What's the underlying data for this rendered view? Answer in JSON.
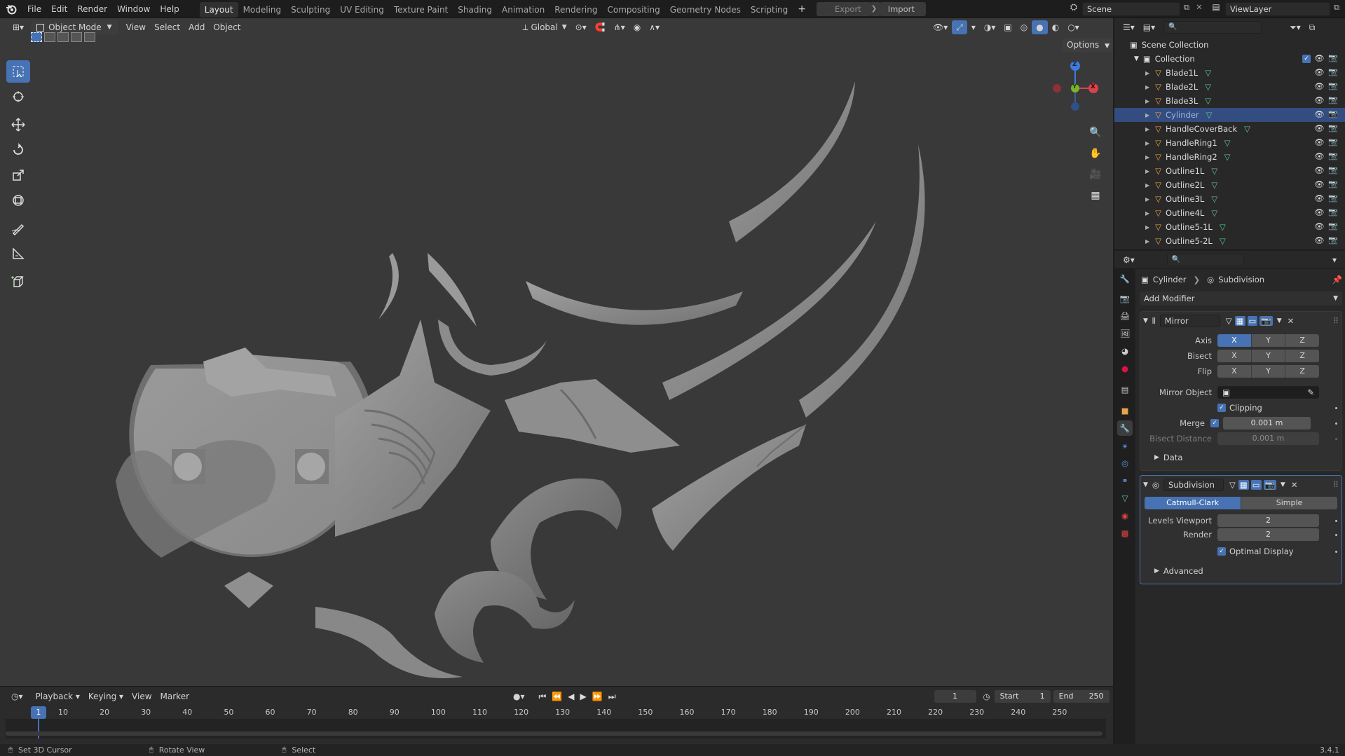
{
  "menu": {
    "items": [
      "File",
      "Edit",
      "Render",
      "Window",
      "Help"
    ],
    "workspaces": [
      "Layout",
      "Modeling",
      "Sculpting",
      "UV Editing",
      "Texture Paint",
      "Shading",
      "Animation",
      "Rendering",
      "Compositing",
      "Geometry Nodes",
      "Scripting"
    ],
    "active_workspace": "Layout",
    "add_workspace": "+",
    "export_label": "Export",
    "import_label": "Import",
    "scene_name": "Scene",
    "view_layer_name": "ViewLayer"
  },
  "viewport_header": {
    "mode": "Object Mode",
    "menus": [
      "View",
      "Select",
      "Add",
      "Object"
    ],
    "transform_orientation": "Global",
    "options_label": "Options"
  },
  "gizmo": {
    "x": "X",
    "y": "Y",
    "z": "Z"
  },
  "outliner": {
    "scene_collection": "Scene Collection",
    "collection": "Collection",
    "objects": [
      {
        "name": "Blade1L",
        "selected": false
      },
      {
        "name": "Blade2L",
        "selected": false
      },
      {
        "name": "Blade3L",
        "selected": false
      },
      {
        "name": "Cylinder",
        "selected": true
      },
      {
        "name": "HandleCoverBack",
        "selected": false
      },
      {
        "name": "HandleRing1",
        "selected": false
      },
      {
        "name": "HandleRing2",
        "selected": false
      },
      {
        "name": "Outline1L",
        "selected": false
      },
      {
        "name": "Outline2L",
        "selected": false
      },
      {
        "name": "Outline3L",
        "selected": false
      },
      {
        "name": "Outline4L",
        "selected": false
      },
      {
        "name": "Outline5-1L",
        "selected": false
      },
      {
        "name": "Outline5-2L",
        "selected": false
      }
    ]
  },
  "properties": {
    "breadcrumb_object": "Cylinder",
    "breadcrumb_modifier": "Subdivision",
    "add_modifier": "Add Modifier",
    "mirror": {
      "name": "Mirror",
      "axis_label": "Axis",
      "bisect_label": "Bisect",
      "flip_label": "Flip",
      "axes": [
        "X",
        "Y",
        "Z"
      ],
      "mirror_object_label": "Mirror Object",
      "clipping_label": "Clipping",
      "merge_label": "Merge",
      "merge_value": "0.001 m",
      "bisect_distance_label": "Bisect Distance",
      "bisect_distance_value": "0.001 m",
      "data_label": "Data"
    },
    "subdivision": {
      "name": "Subdivision",
      "catmull_clark": "Catmull-Clark",
      "simple": "Simple",
      "levels_viewport_label": "Levels Viewport",
      "levels_viewport_value": "2",
      "render_label": "Render",
      "render_value": "2",
      "optimal_display_label": "Optimal Display",
      "advanced_label": "Advanced"
    }
  },
  "timeline": {
    "menus": [
      "Playback",
      "Keying",
      "View",
      "Marker"
    ],
    "current_frame": "1",
    "start_label": "Start",
    "start_value": "1",
    "end_label": "End",
    "end_value": "250",
    "ruler": [
      "10",
      "20",
      "30",
      "40",
      "50",
      "60",
      "70",
      "80",
      "90",
      "100",
      "110",
      "120",
      "130",
      "140",
      "150",
      "160",
      "170",
      "180",
      "190",
      "200",
      "210",
      "220",
      "230",
      "240",
      "250"
    ],
    "playhead_label": "1"
  },
  "statusbar": {
    "left_action": "Set 3D Cursor",
    "middle_action": "Rotate View",
    "right_action": "Select",
    "version": "3.4.1"
  },
  "colors": {
    "accent": "#4772b3",
    "selected_row": "#334d80",
    "viewport_bg": "#393939",
    "mesh_gray": "#8f8f8f",
    "object_orange": "#e8a24a",
    "mesh_green": "#5fc48d"
  }
}
